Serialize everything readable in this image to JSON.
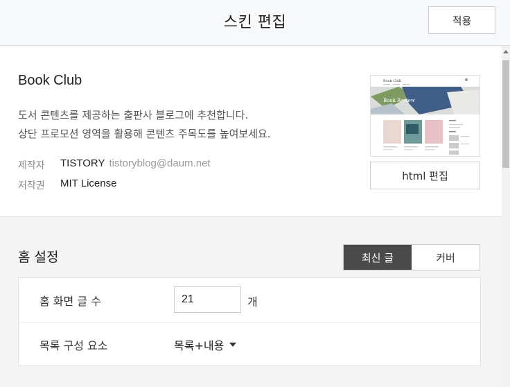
{
  "header": {
    "title": "스킨 편집",
    "apply_label": "적용"
  },
  "skin": {
    "name": "Book Club",
    "description": [
      "도서 콘텐츠를 제공하는 출판사 블로그에 추천합니다.",
      "상단 프로모션 영역을 활용해 콘텐츠 주목도를 높여보세요."
    ],
    "maker_label": "제작자",
    "maker": "TISTORY",
    "maker_email": "tistoryblog@daum.net",
    "license_label": "저작권",
    "license": "MIT License",
    "html_edit_label": "html 편집",
    "thumbnail": {
      "site_title": "Book Club",
      "hero_text": "Book Review"
    }
  },
  "home_settings": {
    "title": "홈 설정",
    "modes": [
      "최신 글",
      "커버"
    ],
    "active_mode": "최신 글",
    "rows": [
      {
        "label": "홈 화면 글 수",
        "value": "21",
        "unit": "개"
      },
      {
        "label": "목록 구성 요소",
        "selected": "목록+내용"
      }
    ]
  },
  "colors": {
    "active_segment": "#4a4a4a",
    "header_bg": "#f7f8fa",
    "page_bg": "#f4f4f4"
  }
}
